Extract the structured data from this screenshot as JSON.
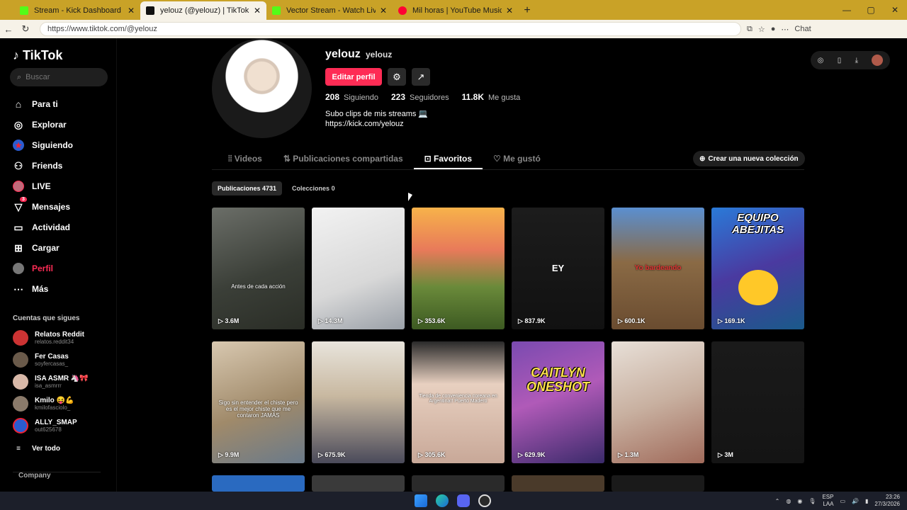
{
  "browser": {
    "tabs": [
      {
        "title": "Stream - Kick Dashboard",
        "color": "#53fc18"
      },
      {
        "title": "yelouz (@yelouz) | TikTok",
        "color": "#111111"
      },
      {
        "title": "Vector Stream - Watch Live on",
        "color": "#53fc18"
      },
      {
        "title": "Mil horas | YouTube Music",
        "color": "#ff0033"
      }
    ],
    "url": "https://www.tiktok.com/@yelouz",
    "chat_label": "Chat"
  },
  "sidebar": {
    "logo": "TikTok",
    "search_placeholder": "Buscar",
    "items": [
      {
        "label": "Para ti",
        "icon": "home-icon"
      },
      {
        "label": "Explorar",
        "icon": "compass-icon"
      },
      {
        "label": "Siguiendo",
        "icon": "following-icon"
      },
      {
        "label": "Friends",
        "icon": "friends-icon"
      },
      {
        "label": "LIVE",
        "icon": "live-icon"
      },
      {
        "label": "Mensajes",
        "icon": "messages-icon",
        "badge": "3"
      },
      {
        "label": "Actividad",
        "icon": "activity-icon"
      },
      {
        "label": "Cargar",
        "icon": "upload-icon"
      },
      {
        "label": "Perfil",
        "icon": "profile-icon"
      },
      {
        "label": "Más",
        "icon": "more-icon"
      }
    ],
    "following_title": "Cuentas que sigues",
    "accounts": [
      {
        "name": "Relatos Reddit",
        "handle": "relatos.reddit34"
      },
      {
        "name": "Fer Casas",
        "handle": "soyfercasas_"
      },
      {
        "name": "ISA ASMR 🦄🎀",
        "handle": "isa_asmrrr"
      },
      {
        "name": "Kmilo 😝💪",
        "handle": "kmilofasciolo_"
      },
      {
        "name": "ALLY_SMAP",
        "handle": "out625678"
      }
    ],
    "see_all": "Ver todo",
    "company": "Company"
  },
  "profile": {
    "username": "yelouz",
    "nickname": "yelouz",
    "edit_label": "Editar perfil",
    "stats": [
      {
        "value": "208",
        "label": "Siguiendo"
      },
      {
        "value": "223",
        "label": "Seguidores"
      },
      {
        "value": "11.8K",
        "label": "Me gusta"
      }
    ],
    "bio": "Subo clips de mis streams 💻",
    "link": "https://kick.com/yelouz"
  },
  "tabs": [
    "Videos",
    "Publicaciones compartidas",
    "Favoritos",
    "Me gustó"
  ],
  "new_collection": "Crear una nueva colección",
  "subtabs": [
    "Publicaciones 4731",
    "Colecciones 0"
  ],
  "videos": [
    {
      "views": "3.6M",
      "caption": "Antes de cada acción",
      "bg": "linear-gradient(160deg,#6b6e68,#3b3f38 55%,#2a2d26)"
    },
    {
      "views": "14.3M",
      "caption": "",
      "bg": "linear-gradient(160deg,#f2f2f2,#d8d8d8 60%,#9aa0a8)"
    },
    {
      "views": "353.6K",
      "caption": "",
      "bg": "linear-gradient(180deg,#f7b24a,#e87a5a 35%,#6a8a3a 65%,#3d5a22)"
    },
    {
      "views": "837.9K",
      "caption": "EY",
      "bg": "linear-gradient(180deg,#1c1c1c,#111)"
    },
    {
      "views": "600.1K",
      "caption": "Yo bardeando",
      "bg": "linear-gradient(180deg,#5a8fd0,#8a6a45 45%,#6a4c30)"
    },
    {
      "views": "169.1K",
      "caption": "EQUIPO ABEJITAS",
      "bg": "linear-gradient(160deg,#2a7ad8,#4a3aa0 50%,#1a5a8a)"
    },
    {
      "views": "9.9M",
      "caption": "Sigo sin entender el chiste pero es el mejor chiste que me contaron JAMÁS",
      "bg": "linear-gradient(160deg,#d8c8b0,#a08a6a 55%,#6a7a8a)"
    },
    {
      "views": "675.9K",
      "caption": "",
      "bg": "linear-gradient(180deg,#e8e4dc,#c8b8a0 45%,#4a4a5a)"
    },
    {
      "views": "305.6K",
      "caption": "Tienda de conveniencia coreana en Argentina!!  Puerto Madero",
      "bg": "linear-gradient(180deg,#2a2a2a,#e8d0c0 35%,#c8a898)"
    },
    {
      "views": "629.9K",
      "caption": "CAITLYN ONESHOT",
      "bg": "linear-gradient(160deg,#7a4ab0,#b05ab8 45%,#3a2a6a)"
    },
    {
      "views": "1.3M",
      "caption": "",
      "bg": "linear-gradient(160deg,#e8e0d8,#c8b0a0 50%,#a06a5a)"
    },
    {
      "views": "3M",
      "caption": "",
      "bg": "linear-gradient(180deg,#1a1a1a,#141414)"
    }
  ],
  "taskbar": {
    "lang": "ESP",
    "lang2": "LAA",
    "time": "23:26",
    "date": "27/3/2026"
  }
}
